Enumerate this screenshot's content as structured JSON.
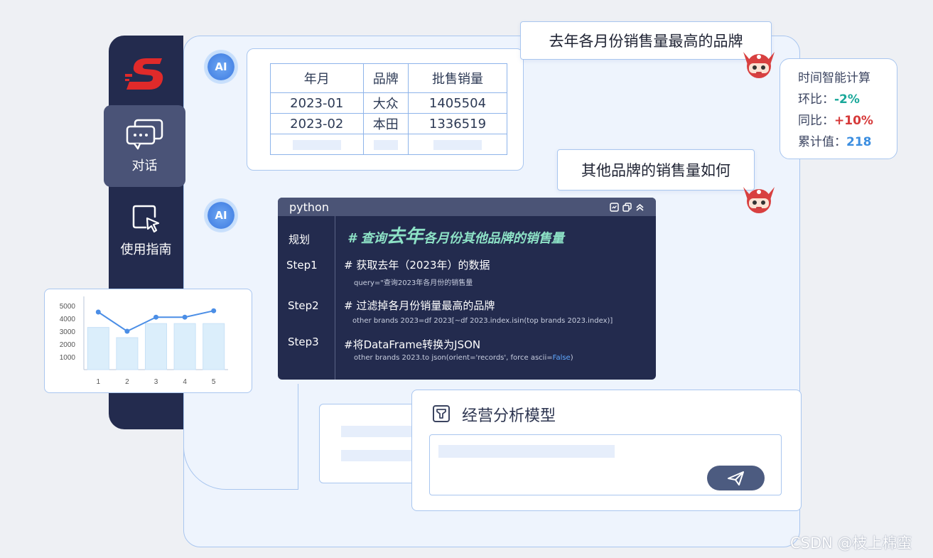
{
  "sidebar": {
    "nav": [
      {
        "label": "对话",
        "icon": "chat-bubbles-icon"
      },
      {
        "label": "使用指南",
        "icon": "cursor-select-icon"
      }
    ]
  },
  "ai_badge": "AI",
  "result_table": {
    "headers": [
      "年月",
      "品牌",
      "批售销量"
    ],
    "rows": [
      [
        "2023-01",
        "大众",
        "1405504"
      ],
      [
        "2023-02",
        "本田",
        "1336519"
      ]
    ]
  },
  "questions": {
    "q1": "去年各月份销售量最高的品牌",
    "q2": "其他品牌的销售量如何"
  },
  "time_intel": {
    "title": "时间智能计算",
    "mom_label": "环比：",
    "mom_value": "-2%",
    "yoy_label": "同比：",
    "yoy_value": "+10%",
    "cum_label": "累计值：",
    "cum_value": "218"
  },
  "code": {
    "language": "python",
    "plan_label": "规划",
    "title_prefix": "# 查询",
    "title_big": "去年",
    "title_suffix": "各月份其他品牌的销售量",
    "steps": [
      {
        "label": "Step1",
        "comment": "# 获取去年（2023年）的数据",
        "code": "query=\"查询2023年各月份的销售量"
      },
      {
        "label": "Step2",
        "comment": "# 过滤掉各月份销量最高的品牌",
        "code": "other brands 2023=df 2023[~df 2023.index.isin(top brands 2023.index)]"
      },
      {
        "label": "Step3",
        "comment": "#将DataFrame转换为JSON",
        "code_prefix": "other brands 2023.to json(orient='records', force ascii=",
        "code_kw": "False",
        "code_suffix": ")"
      }
    ]
  },
  "chart_data": {
    "type": "bar",
    "categories": [
      "1",
      "2",
      "3",
      "4",
      "5"
    ],
    "yticks": [
      1000,
      2000,
      3000,
      4000,
      5000
    ],
    "ylim": [
      0,
      5500
    ],
    "series": [
      {
        "type": "bar",
        "values": [
          3300,
          2500,
          3600,
          3600,
          3600
        ]
      },
      {
        "type": "line",
        "values": [
          4500,
          3000,
          4100,
          4100,
          4600
        ]
      }
    ]
  },
  "model_card": {
    "title": "经营分析模型",
    "icon": "filter-icon"
  },
  "watermark": "CSDN @枝上棉蛮",
  "colors": {
    "sidebar": "#232b4e",
    "accent_blue": "#4b87e6",
    "border": "#a9c6ef"
  }
}
